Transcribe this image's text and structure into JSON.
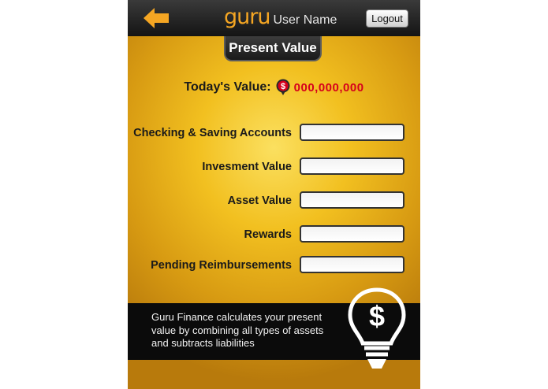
{
  "header": {
    "logo_text": "guru",
    "username": "User Name",
    "logout_label": "Logout",
    "back_icon": "back-arrow-icon"
  },
  "page": {
    "title": "Present Value"
  },
  "summary": {
    "label": "Today's Value:",
    "value": "000,000,000",
    "icon": "dollar-coin-icon"
  },
  "fields": [
    {
      "label": "Checking & Saving Accounts",
      "value": ""
    },
    {
      "label": "Invesment Value",
      "value": ""
    },
    {
      "label": "Asset Value",
      "value": ""
    },
    {
      "label": "Rewards",
      "value": ""
    },
    {
      "label": "Pending Reimbursements",
      "value": ""
    }
  ],
  "info": {
    "text": "Guru Finance calculates your present value by combining all types of assets and subtracts liabilities",
    "icon": "lightbulb-dollar-icon"
  },
  "colors": {
    "accent_orange": "#f5a623",
    "value_red": "#d6001c",
    "bar_dark": "#141414",
    "gold": "#f2c020"
  }
}
